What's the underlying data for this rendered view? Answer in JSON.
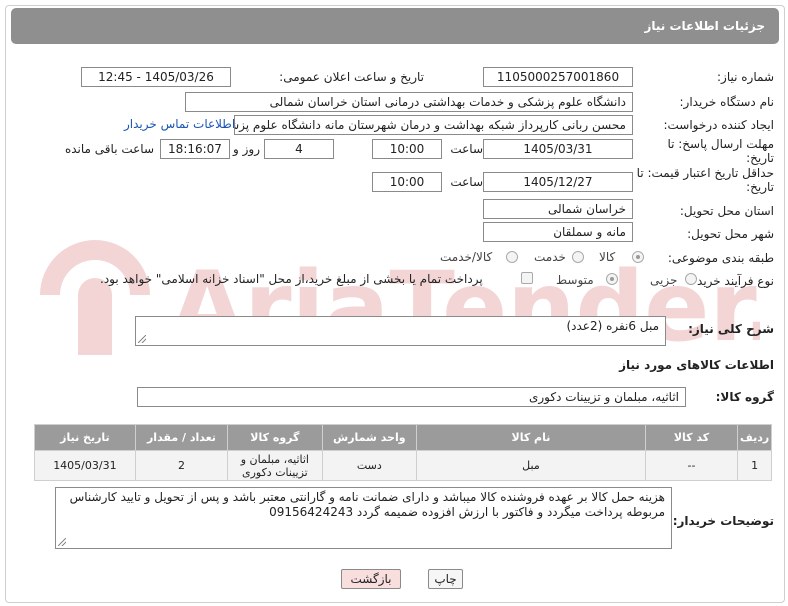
{
  "header": {
    "title": "جزئیات اطلاعات نیاز"
  },
  "watermark": {
    "text": "AriaTender.neT"
  },
  "form": {
    "need_number_label": "شماره نیاز:",
    "need_number": "1105000257001860",
    "announce_label": "تاریخ و ساعت اعلان عمومی:",
    "announce_value": "1405/03/26 - 12:45",
    "buyer_org_label": "نام دستگاه خریدار:",
    "buyer_org": "دانشگاه علوم پزشکی و خدمات بهداشتی درمانی استان خراسان شمالی",
    "creator_label": "ایجاد کننده درخواست:",
    "creator": "محسن ربانی کارپرداز شبکه بهداشت و درمان شهرستان مانه دانشگاه علوم پزشکی",
    "contact_link": "اطلاعات تماس خریدار",
    "deadline_label": "مهلت ارسال پاسخ: تا تاریخ:",
    "deadline_date": "1405/03/31",
    "time_label": "ساعت",
    "deadline_time": "10:00",
    "days_value": "4",
    "days_label": "روز و",
    "remaining_time": "18:16:07",
    "remaining_label": "ساعت باقی مانده",
    "price_valid_label": "حداقل تاریخ اعتبار قیمت: تا تاریخ:",
    "price_valid_date": "1405/12/27",
    "price_valid_time": "10:00",
    "province_label": "استان محل تحویل:",
    "province": "خراسان شمالی",
    "city_label": "شهر محل تحویل:",
    "city": "مانه و سملقان",
    "category_label": "طبقه بندی موضوعی:",
    "category_options": [
      "کالا",
      "خدمت",
      "کالا/خدمت"
    ],
    "category_selected": "کالا",
    "process_label": "نوع فرآیند خرید :",
    "process_options": [
      "جزیی",
      "متوسط"
    ],
    "process_selected": "متوسط",
    "payment_note": "پرداخت تمام یا بخشی از مبلغ خرید،از محل \"اسناد خزانه اسلامی\" خواهد بود."
  },
  "summary": {
    "label": "شرح کلی نیاز:",
    "value": "مبل 6نفره (2عدد)"
  },
  "goods": {
    "section_title": "اطلاعات کالاهای مورد نیاز",
    "group_label": "گروه کالا:",
    "group_value": "اثاثیه، مبلمان و تزیینات دکوری",
    "columns": [
      "ردیف",
      "کد کالا",
      "نام کالا",
      "واحد شمارش",
      "گروه کالا",
      "تعداد / مقدار",
      "تاریخ نیاز"
    ],
    "rows": [
      [
        "1",
        "--",
        "مبل",
        "دست",
        "اثاثیه، مبلمان و تزیینات دکوری",
        "2",
        "1405/03/31"
      ]
    ]
  },
  "buyer_notes": {
    "label": "توضیحات خریدار:",
    "value": "هزینه حمل کالا بر عهده فروشنده کالا میباشد و دارای ضمانت نامه و گارانتی معتبر باشد و پس از تحویل و تایید کارشناس مربوطه پرداخت میگردد و فاکتور با ارزش افزوده ضمیمه گردد 09156424243"
  },
  "buttons": {
    "print": "چاپ",
    "back": "بازگشت"
  },
  "colors": {
    "header_bg": "#8f8f8f",
    "table_header_bg": "#9b9b9b",
    "back_bg": "#f9dede",
    "link": "#1a55b3"
  }
}
